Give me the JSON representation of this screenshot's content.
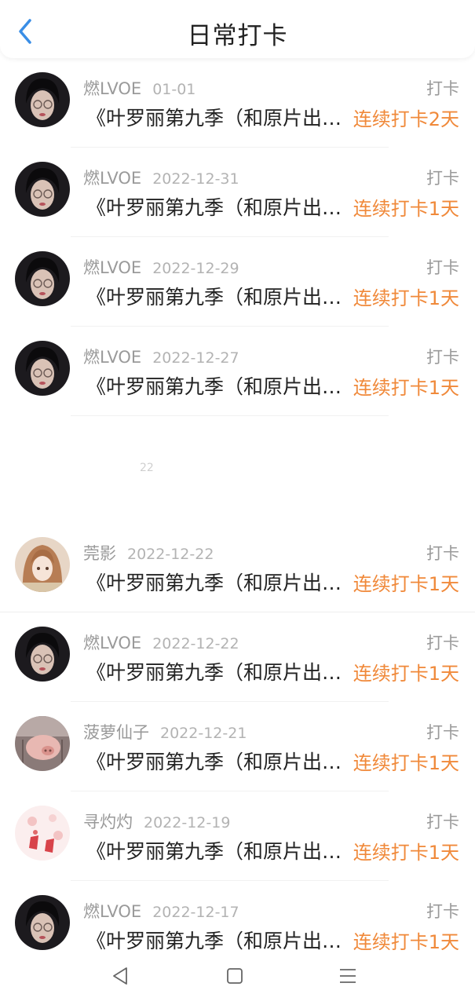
{
  "header": {
    "title": "日常打卡"
  },
  "rows": [
    {
      "name": "燃LVOE",
      "date": "01-01",
      "action": "打卡",
      "content": "《叶罗丽第九季（和原片出入较大）》",
      "streak": "连续打卡2天",
      "avatar": "dark-hair"
    },
    {
      "name": "燃LVOE",
      "date": "2022-12-31",
      "action": "打卡",
      "content": "《叶罗丽第九季（和原片出入较大）》",
      "streak": "连续打卡1天",
      "avatar": "dark-hair"
    },
    {
      "name": "燃LVOE",
      "date": "2022-12-29",
      "action": "打卡",
      "content": "《叶罗丽第九季（和原片出入较大）》",
      "streak": "连续打卡1天",
      "avatar": "dark-hair"
    },
    {
      "name": "燃LVOE",
      "date": "2022-12-27",
      "action": "打卡",
      "content": "《叶罗丽第九季（和原片出入较大）》",
      "streak": "连续打卡1天",
      "avatar": "dark-hair"
    },
    {
      "name": "莞影",
      "date": "2022-12-22",
      "action": "打卡",
      "content": "《叶罗丽第九季（和原片出入较大）》",
      "streak": "连续打卡1天",
      "avatar": "anime-girl"
    },
    {
      "name": "燃LVOE",
      "date": "2022-12-22",
      "action": "打卡",
      "content": "《叶罗丽第九季（和原片出入较大）》",
      "streak": "连续打卡1天",
      "avatar": "dark-hair"
    },
    {
      "name": "菠萝仙子",
      "date": "2022-12-21",
      "action": "打卡",
      "content": "《叶罗丽第九季（和原片出入较大）》",
      "streak": "连续打卡1天",
      "avatar": "pig"
    },
    {
      "name": "寻灼灼",
      "date": "2022-12-19",
      "action": "打卡",
      "content": "《叶罗丽第九季（和原片出入较大）》",
      "streak": "连续打卡1天",
      "avatar": "pink-flower"
    },
    {
      "name": "燃LVOE",
      "date": "2022-12-17",
      "action": "打卡",
      "content": "《叶罗丽第九季（和原片出入较大）》",
      "streak": "连续打卡1天",
      "avatar": "dark-hair"
    }
  ],
  "gap_marker": "22",
  "navbar": {
    "icons": [
      "back-triangle-icon",
      "home-square-icon",
      "menu-lines-icon"
    ]
  },
  "colors": {
    "accent": "#3a8ee6",
    "streak": "#f0893a"
  }
}
